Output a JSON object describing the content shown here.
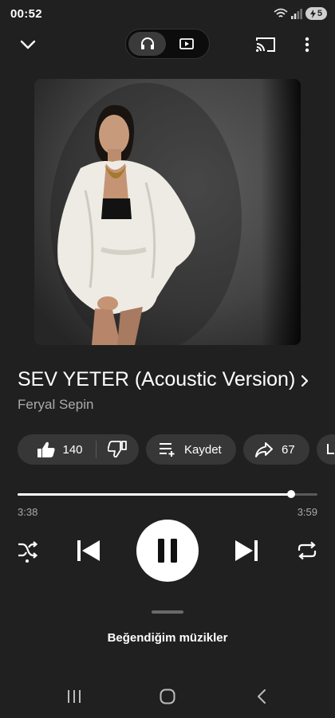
{
  "status_bar": {
    "time": "00:52",
    "battery_level": "5"
  },
  "player_toggle": {
    "active": "audio"
  },
  "track": {
    "title": "SEV YETER (Acoustic Version)",
    "artist": "Feryal Sepin"
  },
  "actions": {
    "like_count": "140",
    "save_label": "Kaydet",
    "share_count": "67"
  },
  "progress": {
    "elapsed": "3:38",
    "total": "3:59",
    "fraction": 0.912
  },
  "queue": {
    "label": "Beğendiğim müzikler"
  },
  "colors": {
    "background": "#202020",
    "pill": "#373737",
    "text_secondary": "#aaaaaa"
  }
}
